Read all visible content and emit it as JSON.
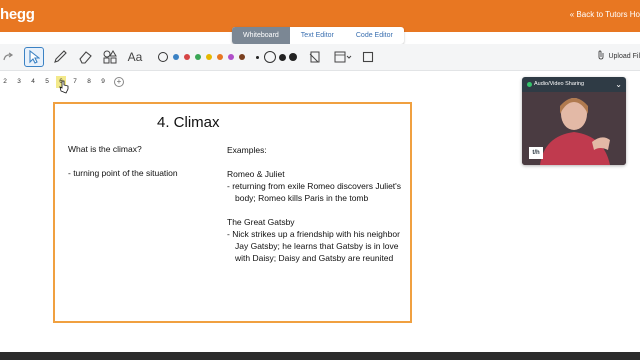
{
  "header": {
    "logo_text": "hegg",
    "back_link": "« Back to Tutors Ho"
  },
  "tabs": [
    {
      "label": "Whiteboard",
      "active": true
    },
    {
      "label": "Text Editor",
      "active": false
    },
    {
      "label": "Code Editor",
      "active": false
    }
  ],
  "toolbar": {
    "tools": [
      "select-arrow-icon",
      "pen-icon",
      "eraser-icon",
      "shapes-icon",
      "text-icon"
    ],
    "text_tool_label": "Aa",
    "colors": [
      "#222222",
      "#3b82c4",
      "#d64545",
      "#3aa655",
      "#e6b800",
      "#e87722",
      "#b04fc9",
      "#7a3f1f"
    ],
    "upload_label": "Upload Fil"
  },
  "pages": {
    "numbers": [
      "2",
      "3",
      "4",
      "5",
      "6",
      "7",
      "8",
      "9"
    ],
    "current": "6"
  },
  "slide": {
    "title": "4. Climax",
    "question": "What is the climax?",
    "answer": "- turning point of the situation",
    "examples_heading": "Examples:",
    "example1_title": "Romeo & Juliet",
    "example1_text": "- returning from exile Romeo discovers Juliet's body; Romeo kills Paris in the tomb",
    "example2_title": "The Great Gatsby",
    "example2_text": "- Nick strikes up a friendship with his neighbor Jay Gatsby; he learns that Gatsby is in love with Daisy; Daisy and Gatsby are reunited"
  },
  "video": {
    "label": "Audio/Video Sharing",
    "logo_text": "t/h"
  },
  "colors": {
    "brand": "#e87722",
    "active_tab": "#7b8794",
    "slide_border": "#f0a040"
  }
}
